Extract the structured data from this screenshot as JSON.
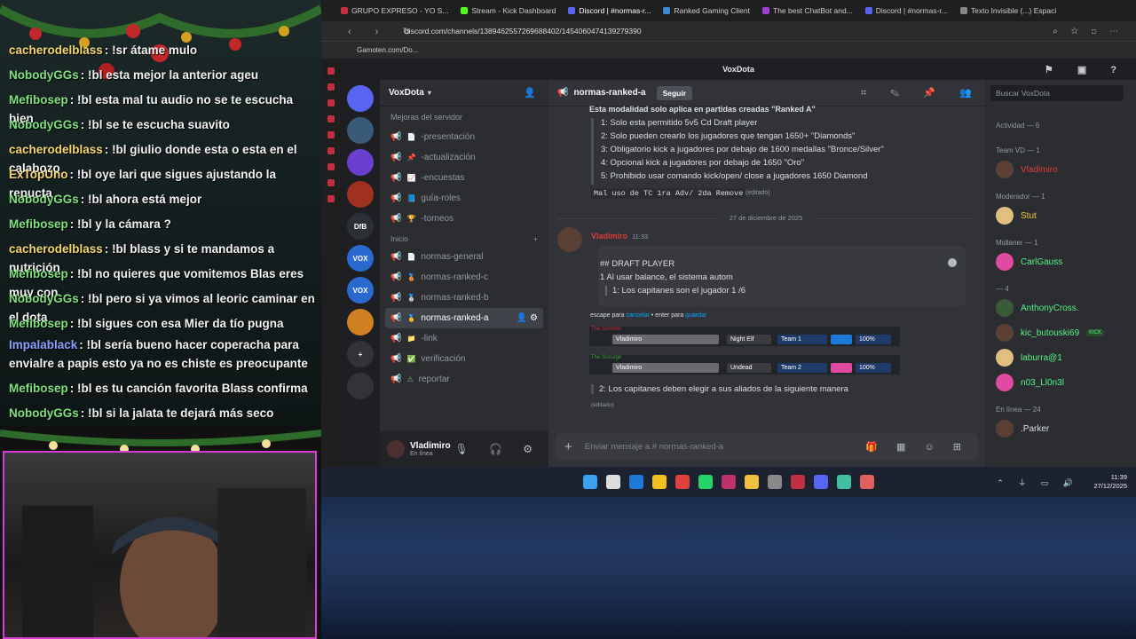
{
  "chat": [
    {
      "user": "cacherodelblass",
      "color": "#f5d76e",
      "text": "!sr átame mulo"
    },
    {
      "user": "NobodyGGs",
      "color": "#7fe07f",
      "text": "!bl esta mejor la anterior ageu"
    },
    {
      "user": "Mefibosep",
      "color": "#7fe07f",
      "text": "!bl esta mal tu audio no se te escucha bien"
    },
    {
      "user": "NobodyGGs",
      "color": "#7fe07f",
      "text": "!bl se te escucha suavito"
    },
    {
      "user": "cacherodelblass",
      "color": "#f5d76e",
      "text": "!bl giulio donde esta o esta en el calabozo"
    },
    {
      "user": "ExTopUno",
      "color": "#f5d76e",
      "text": "!bl oye lari que sigues ajustando la repucta"
    },
    {
      "user": "NobodyGGs",
      "color": "#7fe07f",
      "text": "!bl ahora está mejor"
    },
    {
      "user": "Mefibosep",
      "color": "#7fe07f",
      "text": "!bl y la cámara ?"
    },
    {
      "user": "cacherodelblass",
      "color": "#f5d76e",
      "text": "!bl blass y si te mandamos a nutrición"
    },
    {
      "user": "Mefibosep",
      "color": "#7fe07f",
      "text": "!bl no quieres que vomitemos Blas eres muy con"
    },
    {
      "user": "NobodyGGs",
      "color": "#7fe07f",
      "text": "!bl pero si ya vimos al leoric caminar en el dota"
    },
    {
      "user": "Mefibosep",
      "color": "#7fe07f",
      "text": "!bl sigues con esa Mier da tío pugna"
    },
    {
      "user": "Impalablack",
      "color": "#8aa0ff",
      "text": "!bl sería bueno hacer coperacha para envialre a papis esto ya no es chiste es preocupante"
    },
    {
      "user": "Mefibosep",
      "color": "#7fe07f",
      "text": "!bl es tu canción favorita Blass confirma"
    },
    {
      "user": "NobodyGGs",
      "color": "#7fe07f",
      "text": "!bl si la jalata te dejará más seco"
    }
  ],
  "browser": {
    "tabs": [
      "GRUPO EXPRESO - YO S...",
      "Stream - Kick Dashboard",
      "Discord | #normas-r...",
      "Ranked Gaming Client",
      "The best ChatBot and...",
      "Discord | #normas-r...",
      "Texto Invisible (...) Espaci"
    ],
    "url": "discord.com/channels/1389462557269688402/1454060474139279390",
    "bookmark": "Gamoten.com/Do...",
    "title": "VoxDota"
  },
  "servers": [
    {
      "label": "",
      "color": "#5865f2"
    },
    {
      "label": "",
      "color": "#3a5a7a"
    },
    {
      "label": "",
      "color": "#6a3fd0"
    },
    {
      "label": "",
      "color": "#a03020"
    },
    {
      "label": "DfB",
      "color": "#2c2f36"
    },
    {
      "label": "VOX",
      "color": "#2a6ad0"
    },
    {
      "label": "VOX",
      "color": "#2a6ad0"
    },
    {
      "label": "",
      "color": "#d08020"
    },
    {
      "label": "+",
      "color": "#313338"
    },
    {
      "label": "",
      "color": "#313338"
    }
  ],
  "channels_panel": {
    "server_name": "VoxDota",
    "top_item": "Mejoras del servidor",
    "channels_a": [
      {
        "name": "-presentación",
        "icon": "📄"
      },
      {
        "name": "-actualización",
        "icon": "📌"
      },
      {
        "name": "-encuestas",
        "icon": "📈"
      },
      {
        "name": "guía-roles",
        "icon": "📘"
      },
      {
        "name": "-torneos",
        "icon": "🏆"
      }
    ],
    "category": "Inicio",
    "channels_b": [
      {
        "name": "normas-general",
        "icon": "📄"
      },
      {
        "name": "normas-ranked-c",
        "icon": "🥉"
      },
      {
        "name": "normas-ranked-b",
        "icon": "🥈"
      },
      {
        "name": "normas-ranked-a",
        "icon": "🥇",
        "active": true
      },
      {
        "name": "-link",
        "icon": "📁"
      },
      {
        "name": "verificación",
        "icon": "✅"
      },
      {
        "name": "reportar",
        "icon": "⚠"
      }
    ],
    "user": {
      "name": "Vladimiro",
      "status": "En línea"
    }
  },
  "main": {
    "channel": "normas-ranked-a",
    "follow": "Seguir",
    "header_text": "Esta modalidad solo aplica en partidas creadas \"Ranked A\"",
    "rules": [
      "1: Solo esta permitido 5v5 Cd Draft player",
      "2: Solo pueden crearlo los jugadores que tengan 1650+ \"Diamonds\"",
      "3: Obligatorio kick a jugadores por debajo de 1600 medallas \"Bronce/Silver\"",
      "4: Opcional kick a jugadores por debajo de 1650 \"Oro\"",
      "5: Prohibido usar comando kick/open/ close a jugadores 1650 Diamond"
    ],
    "code_line": "Mal uso de TC 1ra Adv/ 2da Remove",
    "edited": "(editado)",
    "date_sep": "27 de diciembre de 2025",
    "author": "Vladimiro",
    "time": "11:33",
    "edit_lines": [
      "## DRAFT PLAYER",
      "1 Al usar balance, el sistema autom",
      "1: Los capitanes son el jugador 1 /6"
    ],
    "edit_hint": {
      "a": "escape para",
      "b": "cancelar",
      "c": "• enter para",
      "d": "guardar"
    },
    "team1": {
      "label": "The Sentinel",
      "player": "Vladimiro",
      "race": "Night Elf",
      "team": "Team 1",
      "pct": "100%"
    },
    "team2": {
      "label": "The Scourge",
      "player": "Vladimiro",
      "race": "Undead",
      "team": "Team 2",
      "pct": "100%"
    },
    "rule2": "2: Los capitanes deben elegir a sus aliados de la siguiente manera",
    "edited2": "(editado)",
    "composer": "Enviar mensaje a #",
    "composer_chan": "normas-ranked-a"
  },
  "members": {
    "search": "Buscar VoxDota",
    "activity": "Actividad — 6",
    "groups": [
      {
        "title": "Team VD — 1",
        "members": [
          {
            "name": "Vladimiro",
            "color": "#e03c3c"
          }
        ]
      },
      {
        "title": "Moderador — 1",
        "members": [
          {
            "name": "Stut",
            "color": "#f5c04a"
          }
        ]
      },
      {
        "title": "Midlaner — 1",
        "members": [
          {
            "name": "CarlGauss",
            "color": "#57f287"
          }
        ]
      },
      {
        "title": "— 4",
        "members": [
          {
            "name": "AnthonyCross.",
            "color": "#57f287"
          },
          {
            "name": "kic_butouski69",
            "color": "#57f287"
          },
          {
            "name": "laburra@1",
            "color": "#57f287"
          },
          {
            "name": "n03_Ll0n3l",
            "color": "#57f287"
          }
        ]
      },
      {
        "title": "En línea — 24",
        "members": [
          {
            "name": ".Parker",
            "color": "#dbdee1"
          }
        ]
      }
    ],
    "kick_badge": "KICK"
  },
  "taskbar": {
    "time": "11:39",
    "date": "27/12/2025"
  }
}
